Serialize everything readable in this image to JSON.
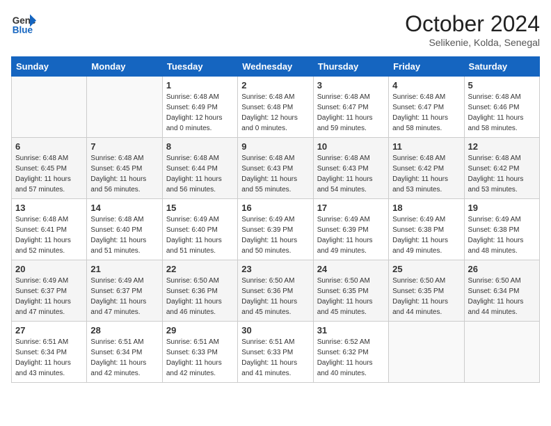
{
  "header": {
    "logo_line1": "General",
    "logo_line2": "Blue",
    "month_title": "October 2024",
    "location": "Selikenie, Kolda, Senegal"
  },
  "weekdays": [
    "Sunday",
    "Monday",
    "Tuesday",
    "Wednesday",
    "Thursday",
    "Friday",
    "Saturday"
  ],
  "weeks": [
    [
      {
        "day": "",
        "sunrise": "",
        "sunset": "",
        "daylight": ""
      },
      {
        "day": "",
        "sunrise": "",
        "sunset": "",
        "daylight": ""
      },
      {
        "day": "1",
        "sunrise": "Sunrise: 6:48 AM",
        "sunset": "Sunset: 6:49 PM",
        "daylight": "Daylight: 12 hours and 0 minutes."
      },
      {
        "day": "2",
        "sunrise": "Sunrise: 6:48 AM",
        "sunset": "Sunset: 6:48 PM",
        "daylight": "Daylight: 12 hours and 0 minutes."
      },
      {
        "day": "3",
        "sunrise": "Sunrise: 6:48 AM",
        "sunset": "Sunset: 6:47 PM",
        "daylight": "Daylight: 11 hours and 59 minutes."
      },
      {
        "day": "4",
        "sunrise": "Sunrise: 6:48 AM",
        "sunset": "Sunset: 6:47 PM",
        "daylight": "Daylight: 11 hours and 58 minutes."
      },
      {
        "day": "5",
        "sunrise": "Sunrise: 6:48 AM",
        "sunset": "Sunset: 6:46 PM",
        "daylight": "Daylight: 11 hours and 58 minutes."
      }
    ],
    [
      {
        "day": "6",
        "sunrise": "Sunrise: 6:48 AM",
        "sunset": "Sunset: 6:45 PM",
        "daylight": "Daylight: 11 hours and 57 minutes."
      },
      {
        "day": "7",
        "sunrise": "Sunrise: 6:48 AM",
        "sunset": "Sunset: 6:45 PM",
        "daylight": "Daylight: 11 hours and 56 minutes."
      },
      {
        "day": "8",
        "sunrise": "Sunrise: 6:48 AM",
        "sunset": "Sunset: 6:44 PM",
        "daylight": "Daylight: 11 hours and 56 minutes."
      },
      {
        "day": "9",
        "sunrise": "Sunrise: 6:48 AM",
        "sunset": "Sunset: 6:43 PM",
        "daylight": "Daylight: 11 hours and 55 minutes."
      },
      {
        "day": "10",
        "sunrise": "Sunrise: 6:48 AM",
        "sunset": "Sunset: 6:43 PM",
        "daylight": "Daylight: 11 hours and 54 minutes."
      },
      {
        "day": "11",
        "sunrise": "Sunrise: 6:48 AM",
        "sunset": "Sunset: 6:42 PM",
        "daylight": "Daylight: 11 hours and 53 minutes."
      },
      {
        "day": "12",
        "sunrise": "Sunrise: 6:48 AM",
        "sunset": "Sunset: 6:42 PM",
        "daylight": "Daylight: 11 hours and 53 minutes."
      }
    ],
    [
      {
        "day": "13",
        "sunrise": "Sunrise: 6:48 AM",
        "sunset": "Sunset: 6:41 PM",
        "daylight": "Daylight: 11 hours and 52 minutes."
      },
      {
        "day": "14",
        "sunrise": "Sunrise: 6:48 AM",
        "sunset": "Sunset: 6:40 PM",
        "daylight": "Daylight: 11 hours and 51 minutes."
      },
      {
        "day": "15",
        "sunrise": "Sunrise: 6:49 AM",
        "sunset": "Sunset: 6:40 PM",
        "daylight": "Daylight: 11 hours and 51 minutes."
      },
      {
        "day": "16",
        "sunrise": "Sunrise: 6:49 AM",
        "sunset": "Sunset: 6:39 PM",
        "daylight": "Daylight: 11 hours and 50 minutes."
      },
      {
        "day": "17",
        "sunrise": "Sunrise: 6:49 AM",
        "sunset": "Sunset: 6:39 PM",
        "daylight": "Daylight: 11 hours and 49 minutes."
      },
      {
        "day": "18",
        "sunrise": "Sunrise: 6:49 AM",
        "sunset": "Sunset: 6:38 PM",
        "daylight": "Daylight: 11 hours and 49 minutes."
      },
      {
        "day": "19",
        "sunrise": "Sunrise: 6:49 AM",
        "sunset": "Sunset: 6:38 PM",
        "daylight": "Daylight: 11 hours and 48 minutes."
      }
    ],
    [
      {
        "day": "20",
        "sunrise": "Sunrise: 6:49 AM",
        "sunset": "Sunset: 6:37 PM",
        "daylight": "Daylight: 11 hours and 47 minutes."
      },
      {
        "day": "21",
        "sunrise": "Sunrise: 6:49 AM",
        "sunset": "Sunset: 6:37 PM",
        "daylight": "Daylight: 11 hours and 47 minutes."
      },
      {
        "day": "22",
        "sunrise": "Sunrise: 6:50 AM",
        "sunset": "Sunset: 6:36 PM",
        "daylight": "Daylight: 11 hours and 46 minutes."
      },
      {
        "day": "23",
        "sunrise": "Sunrise: 6:50 AM",
        "sunset": "Sunset: 6:36 PM",
        "daylight": "Daylight: 11 hours and 45 minutes."
      },
      {
        "day": "24",
        "sunrise": "Sunrise: 6:50 AM",
        "sunset": "Sunset: 6:35 PM",
        "daylight": "Daylight: 11 hours and 45 minutes."
      },
      {
        "day": "25",
        "sunrise": "Sunrise: 6:50 AM",
        "sunset": "Sunset: 6:35 PM",
        "daylight": "Daylight: 11 hours and 44 minutes."
      },
      {
        "day": "26",
        "sunrise": "Sunrise: 6:50 AM",
        "sunset": "Sunset: 6:34 PM",
        "daylight": "Daylight: 11 hours and 44 minutes."
      }
    ],
    [
      {
        "day": "27",
        "sunrise": "Sunrise: 6:51 AM",
        "sunset": "Sunset: 6:34 PM",
        "daylight": "Daylight: 11 hours and 43 minutes."
      },
      {
        "day": "28",
        "sunrise": "Sunrise: 6:51 AM",
        "sunset": "Sunset: 6:34 PM",
        "daylight": "Daylight: 11 hours and 42 minutes."
      },
      {
        "day": "29",
        "sunrise": "Sunrise: 6:51 AM",
        "sunset": "Sunset: 6:33 PM",
        "daylight": "Daylight: 11 hours and 42 minutes."
      },
      {
        "day": "30",
        "sunrise": "Sunrise: 6:51 AM",
        "sunset": "Sunset: 6:33 PM",
        "daylight": "Daylight: 11 hours and 41 minutes."
      },
      {
        "day": "31",
        "sunrise": "Sunrise: 6:52 AM",
        "sunset": "Sunset: 6:32 PM",
        "daylight": "Daylight: 11 hours and 40 minutes."
      },
      {
        "day": "",
        "sunrise": "",
        "sunset": "",
        "daylight": ""
      },
      {
        "day": "",
        "sunrise": "",
        "sunset": "",
        "daylight": ""
      }
    ]
  ]
}
